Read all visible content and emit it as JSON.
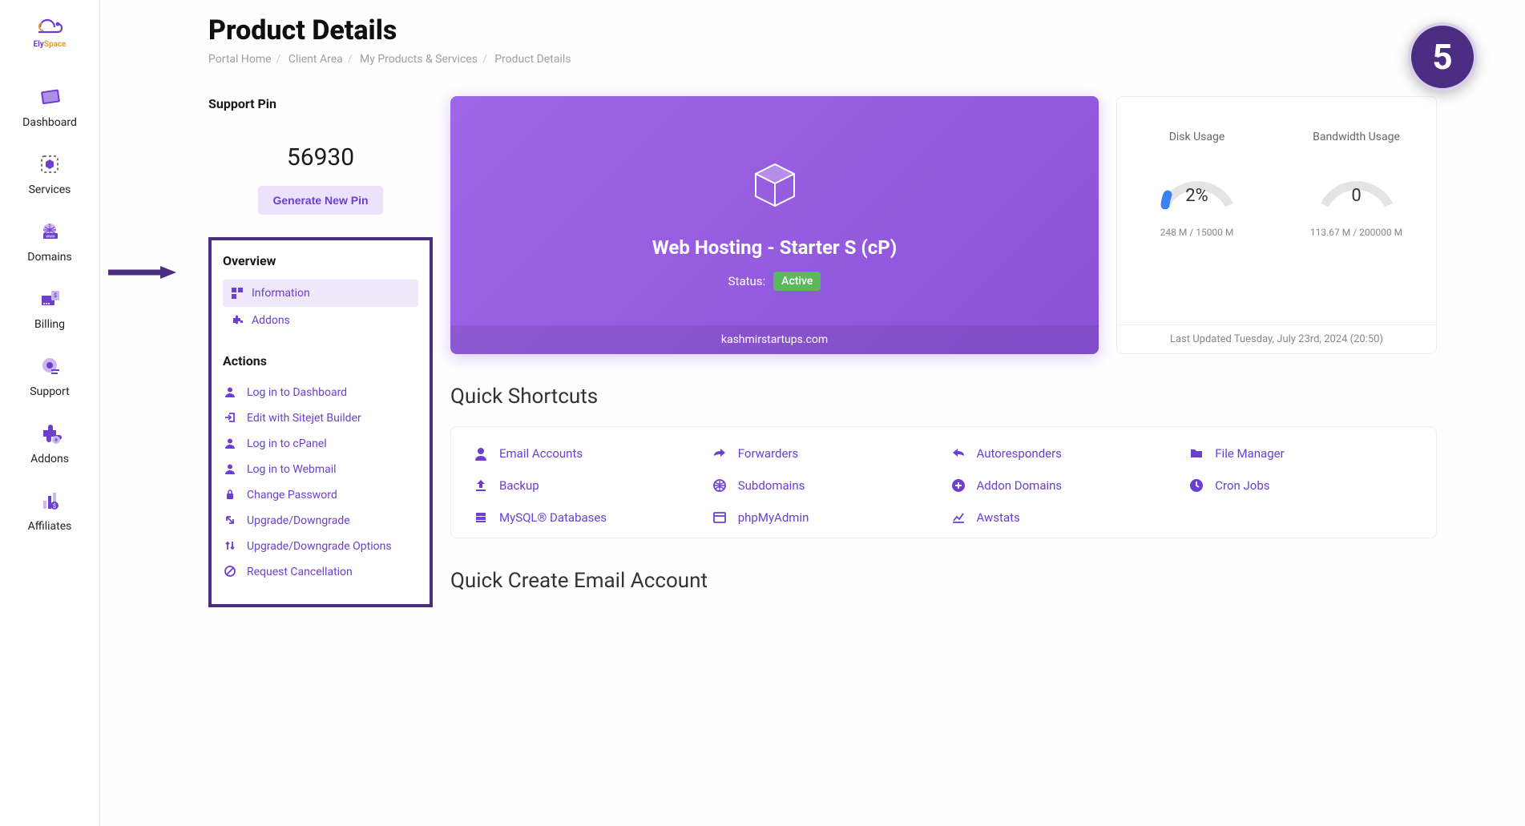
{
  "logo": {
    "ely": "Ely",
    "space": "Space"
  },
  "sidebar": {
    "items": [
      {
        "label": "Dashboard"
      },
      {
        "label": "Services"
      },
      {
        "label": "Domains"
      },
      {
        "label": "Billing"
      },
      {
        "label": "Support"
      },
      {
        "label": "Addons"
      },
      {
        "label": "Affiliates"
      }
    ]
  },
  "page": {
    "title": "Product Details",
    "breadcrumb": {
      "portal_home": "Portal Home",
      "client_area": "Client Area",
      "my_products": "My Products & Services",
      "current": "Product Details"
    }
  },
  "support_pin": {
    "label": "Support Pin",
    "value": "56930",
    "generate_label": "Generate New Pin"
  },
  "overview": {
    "heading": "Overview",
    "information": "Information",
    "addons": "Addons"
  },
  "actions": {
    "heading": "Actions",
    "items": [
      "Log in to Dashboard",
      "Edit with Sitejet Builder",
      "Log in to cPanel",
      "Log in to Webmail",
      "Change Password",
      "Upgrade/Downgrade",
      "Upgrade/Downgrade Options",
      "Request Cancellation"
    ]
  },
  "hero": {
    "product": "Web Hosting - Starter S (cP)",
    "status_label": "Status:",
    "status": "Active",
    "domain": "kashmirstartups.com"
  },
  "usage": {
    "disk": {
      "title": "Disk Usage",
      "value": "2%",
      "sub": "248 M / 15000 M",
      "pct": 2
    },
    "bandwidth": {
      "title": "Bandwidth Usage",
      "value": "0",
      "sub": "113.67 M / 200000 M",
      "pct": 0
    },
    "updated": "Last Updated Tuesday, July 23rd, 2024 (20:50)"
  },
  "shortcuts": {
    "title": "Quick Shortcuts",
    "items": [
      "Email Accounts",
      "Forwarders",
      "Autoresponders",
      "File Manager",
      "Backup",
      "Subdomains",
      "Addon Domains",
      "Cron Jobs",
      "MySQL® Databases",
      "phpMyAdmin",
      "Awstats"
    ]
  },
  "quick_email": {
    "title": "Quick Create Email Account"
  },
  "step_badge": "5"
}
